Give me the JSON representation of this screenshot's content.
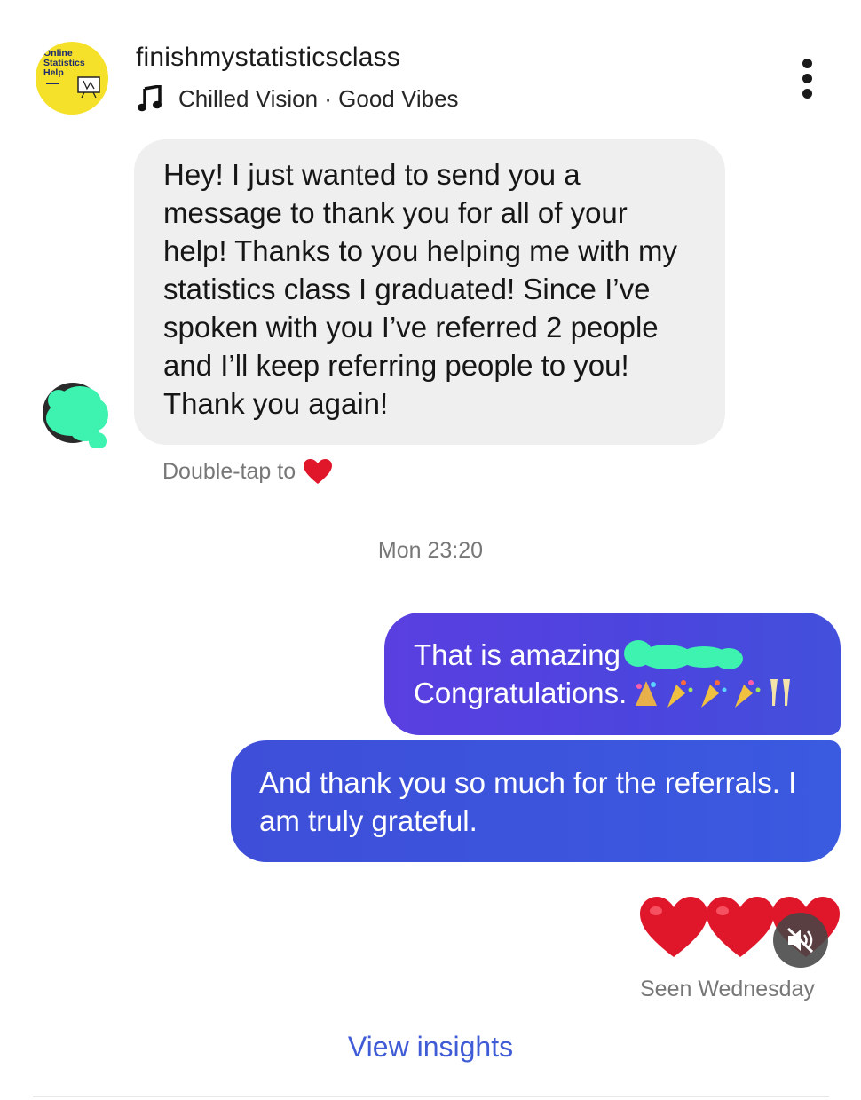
{
  "header": {
    "username": "finishmystatisticsclass",
    "music_label": "Chilled Vision · Good Vibes",
    "avatar_logo_lines": [
      "Online",
      "Statistics",
      "Help"
    ]
  },
  "incoming_message": {
    "text": "Hey! I just wanted to send you a\nmessage to thank you for all of your\nhelp! Thanks to you helping me with my\nstatistics class I graduated! Since I’ve\nspoken with you I’ve referred 2 people\nand I’ll keep referring people to you!\nThank you again!",
    "double_tap_hint": "Double-tap to"
  },
  "timestamp": "Mon 23:20",
  "outgoing_messages": {
    "first_line_1": "That is amazing",
    "first_line_2": "Congratulations.",
    "second": "And thank you so much for the referrals. I\nam truly grateful."
  },
  "reactions": {
    "hearts_count": 3
  },
  "status": {
    "seen": "Seen Wednesday"
  },
  "footer": {
    "view_insights": "View insights"
  },
  "colors": {
    "outgoing_bubble": "#4a4ade",
    "incoming_bubble": "#efefef",
    "link": "#3f5bd6",
    "redaction": "#3ef2b0",
    "heart": "#e0162b"
  }
}
